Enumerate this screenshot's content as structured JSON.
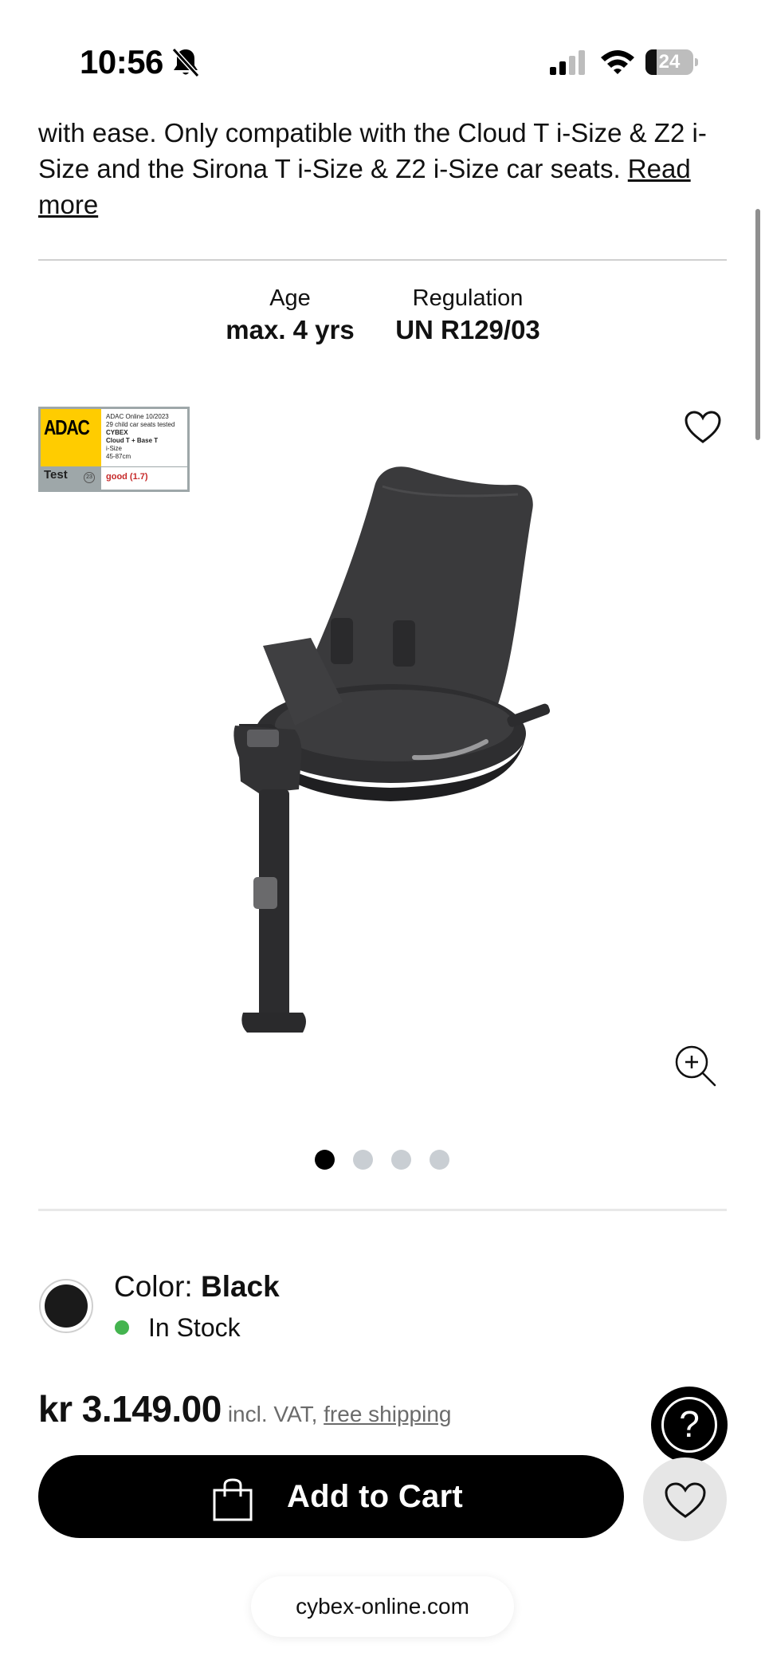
{
  "status_bar": {
    "time": "10:56",
    "battery": "24",
    "battery_level": 0.24
  },
  "description": {
    "text": "with ease. Only compatible with the Cloud T i-Size & Z2 i-Size and the Sirona T i-Size & Z2 i-Size car seats. ",
    "read_more": "Read more"
  },
  "specs": [
    {
      "label": "Age",
      "value": "max. 4 yrs"
    },
    {
      "label": "Regulation",
      "value": "UN R129/03"
    }
  ],
  "adac": {
    "logo": "ADAC",
    "line1": "ADAC Online 10/2023",
    "line2": "29 child car seats tested",
    "brand": "CYBEX",
    "product": "Cloud T + Base T",
    "size": "i-Size",
    "range": "45-87cm",
    "test_label": "Test",
    "grade": "good (1.7)"
  },
  "gallery": {
    "dots": 4,
    "active": 0,
    "colors": {
      "active": "#000000",
      "inactive": "#c9ced3"
    }
  },
  "variant": {
    "color_label": "Color: ",
    "color_value": "Black",
    "swatch_color": "#1a1a1a",
    "stock": "In Stock",
    "stock_color": "#44b44f"
  },
  "pricing": {
    "price": "kr 3.149.00",
    "vat": "incl. VAT, ",
    "shipping": "free shipping"
  },
  "actions": {
    "add_to_cart": "Add to Cart",
    "help": "?"
  },
  "browser": {
    "url": "cybex-online.com"
  }
}
